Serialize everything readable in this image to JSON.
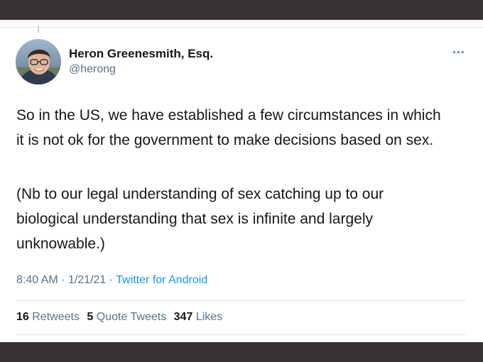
{
  "tweet": {
    "display_name": "Heron Greenesmith, Esq.",
    "handle": "@herong",
    "more_icon": "more-horizontal-icon",
    "paragraphs": [
      "So in the US, we have established a few circumstances in which it is not ok for the government to make decisions based on sex.",
      "(Nb to our legal understanding of sex catching up to our biological understanding that sex is infinite and largely unknowable.)"
    ],
    "time": "8:40 AM",
    "date": "1/21/21",
    "separator": "·",
    "source": "Twitter for Android"
  },
  "stats": {
    "retweets_count": "16",
    "retweets_label": "Retweets",
    "quote_count": "5",
    "quote_label": "Quote Tweets",
    "likes_count": "347",
    "likes_label": "Likes"
  },
  "colors": {
    "frame": "#3a3132",
    "link": "#1b95e0",
    "secondary_text": "#5b7083",
    "primary_text": "#14171a"
  }
}
